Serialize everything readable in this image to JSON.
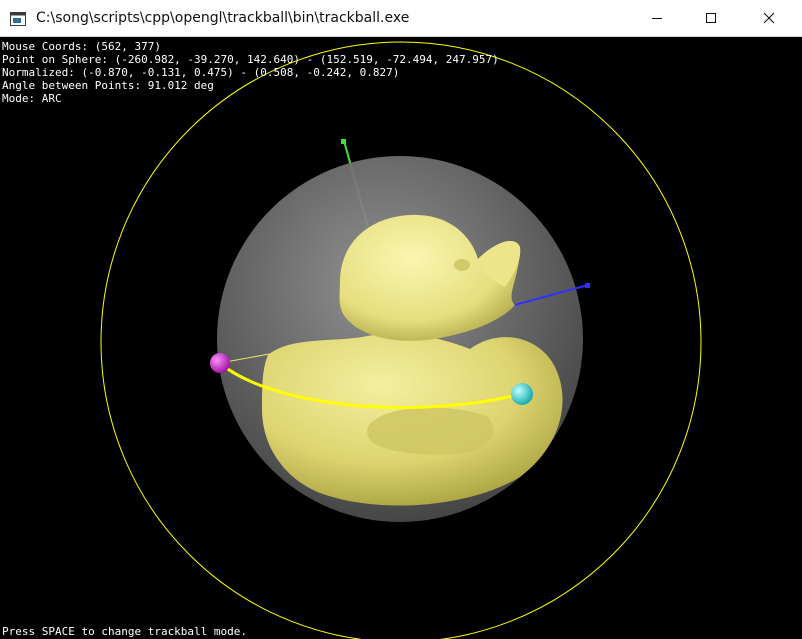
{
  "window": {
    "title": "C:\\song\\scripts\\cpp\\opengl\\trackball\\bin\\trackball.exe",
    "app_icon": "console-window-icon",
    "controls": {
      "minimize_icon": "minimize-icon",
      "maximize_icon": "maximize-icon",
      "close_icon": "close-icon"
    }
  },
  "overlay": {
    "mouse_coords": "Mouse Coords: (562, 377)",
    "point_on_sphere": "Point on Sphere: (-260.982, -39.270, 142.640) - (152.519, -72.494, 247.957)",
    "normalized": "Normalized: (-0.870, -0.131, 0.475) - (0.508, -0.242, 0.827)",
    "angle": "Angle between Points: 91.012 deg",
    "mode": "Mode: ARC"
  },
  "footer": {
    "hint": "Press SPACE to change trackball mode."
  },
  "scene": {
    "background_color": "#000000",
    "trackball_circle_color": "#ffff00",
    "sphere_color": "#8a8a8a",
    "duck_color": "#e8e07a",
    "arc_color": "#ffff00",
    "start_point_color": "#e020e0",
    "end_point_color": "#20e8e8",
    "axis_y_color": "#40e040",
    "axis_z_color": "#3030ff"
  }
}
